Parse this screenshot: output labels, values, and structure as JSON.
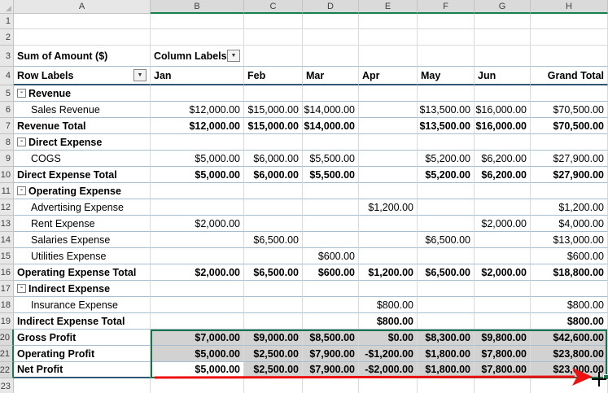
{
  "sheet": {
    "columns": [
      "A",
      "B",
      "C",
      "D",
      "E",
      "F",
      "G",
      "H"
    ],
    "row_count": 23,
    "selected_columns": [
      "B",
      "C",
      "D",
      "E",
      "F",
      "G",
      "H"
    ],
    "selected_rows": [
      20,
      21,
      22
    ]
  },
  "pivot": {
    "value_field_label": "Sum of Amount ($)",
    "column_labels_label": "Column Labels",
    "row_labels_label": "Row Labels",
    "column_headers": [
      "Jan",
      "Feb",
      "Mar",
      "Apr",
      "May",
      "Jun",
      "Grand Total"
    ],
    "rows": [
      {
        "row": 5,
        "kind": "group",
        "label": "Revenue",
        "values": [
          "",
          "",
          "",
          "",
          "",
          "",
          ""
        ]
      },
      {
        "row": 6,
        "kind": "item",
        "label": "Sales Revenue",
        "values": [
          "$12,000.00",
          "$15,000.00",
          "$14,000.00",
          "",
          "$13,500.00",
          "$16,000.00",
          "$70,500.00"
        ]
      },
      {
        "row": 7,
        "kind": "total",
        "label": "Revenue Total",
        "values": [
          "$12,000.00",
          "$15,000.00",
          "$14,000.00",
          "",
          "$13,500.00",
          "$16,000.00",
          "$70,500.00"
        ]
      },
      {
        "row": 8,
        "kind": "group",
        "label": "Direct Expense",
        "values": [
          "",
          "",
          "",
          "",
          "",
          "",
          ""
        ]
      },
      {
        "row": 9,
        "kind": "item",
        "label": "COGS",
        "values": [
          "$5,000.00",
          "$6,000.00",
          "$5,500.00",
          "",
          "$5,200.00",
          "$6,200.00",
          "$27,900.00"
        ]
      },
      {
        "row": 10,
        "kind": "total",
        "label": "Direct Expense Total",
        "values": [
          "$5,000.00",
          "$6,000.00",
          "$5,500.00",
          "",
          "$5,200.00",
          "$6,200.00",
          "$27,900.00"
        ]
      },
      {
        "row": 11,
        "kind": "group",
        "label": "Operating Expense",
        "values": [
          "",
          "",
          "",
          "",
          "",
          "",
          ""
        ]
      },
      {
        "row": 12,
        "kind": "item",
        "label": "Advertising Expense",
        "values": [
          "",
          "",
          "",
          "$1,200.00",
          "",
          "",
          "$1,200.00"
        ]
      },
      {
        "row": 13,
        "kind": "item",
        "label": "Rent Expense",
        "values": [
          "$2,000.00",
          "",
          "",
          "",
          "",
          "$2,000.00",
          "$4,000.00"
        ]
      },
      {
        "row": 14,
        "kind": "item",
        "label": "Salaries Expense",
        "values": [
          "",
          "$6,500.00",
          "",
          "",
          "$6,500.00",
          "",
          "$13,000.00"
        ]
      },
      {
        "row": 15,
        "kind": "item",
        "label": "Utilities Expense",
        "values": [
          "",
          "",
          "$600.00",
          "",
          "",
          "",
          "$600.00"
        ]
      },
      {
        "row": 16,
        "kind": "total",
        "label": "Operating Expense Total",
        "values": [
          "$2,000.00",
          "$6,500.00",
          "$600.00",
          "$1,200.00",
          "$6,500.00",
          "$2,000.00",
          "$18,800.00"
        ]
      },
      {
        "row": 17,
        "kind": "group",
        "label": "Indirect Expense",
        "values": [
          "",
          "",
          "",
          "",
          "",
          "",
          ""
        ]
      },
      {
        "row": 18,
        "kind": "item",
        "label": "Insurance Expense",
        "values": [
          "",
          "",
          "",
          "$800.00",
          "",
          "",
          "$800.00"
        ]
      },
      {
        "row": 19,
        "kind": "total",
        "label": "Indirect Expense Total",
        "values": [
          "",
          "",
          "",
          "$800.00",
          "",
          "",
          "$800.00"
        ]
      },
      {
        "row": 20,
        "kind": "profit",
        "label": "Gross Profit",
        "values": [
          "$7,000.00",
          "$9,000.00",
          "$8,500.00",
          "$0.00",
          "$8,300.00",
          "$9,800.00",
          "$42,600.00"
        ]
      },
      {
        "row": 21,
        "kind": "profit",
        "label": "Operating Profit",
        "values": [
          "$5,000.00",
          "$2,500.00",
          "$7,900.00",
          "-$1,200.00",
          "$1,800.00",
          "$7,800.00",
          "$23,800.00"
        ]
      },
      {
        "row": 22,
        "kind": "profit",
        "label": "Net Profit",
        "values": [
          "$5,000.00",
          "$2,500.00",
          "$7,900.00",
          "-$2,000.00",
          "$1,800.00",
          "$7,800.00",
          "$23,000.00"
        ]
      }
    ]
  },
  "selection": {
    "range": "B20:H22",
    "active_cell": "B22",
    "fill_color": "#d2d2d2",
    "border_color": "#17724a"
  },
  "annotations": {
    "arrow_color": "#ee1111",
    "cursor_color": "#000000"
  },
  "icons": {
    "collapse_glyph": "-",
    "dropdown_glyph": "▼"
  }
}
